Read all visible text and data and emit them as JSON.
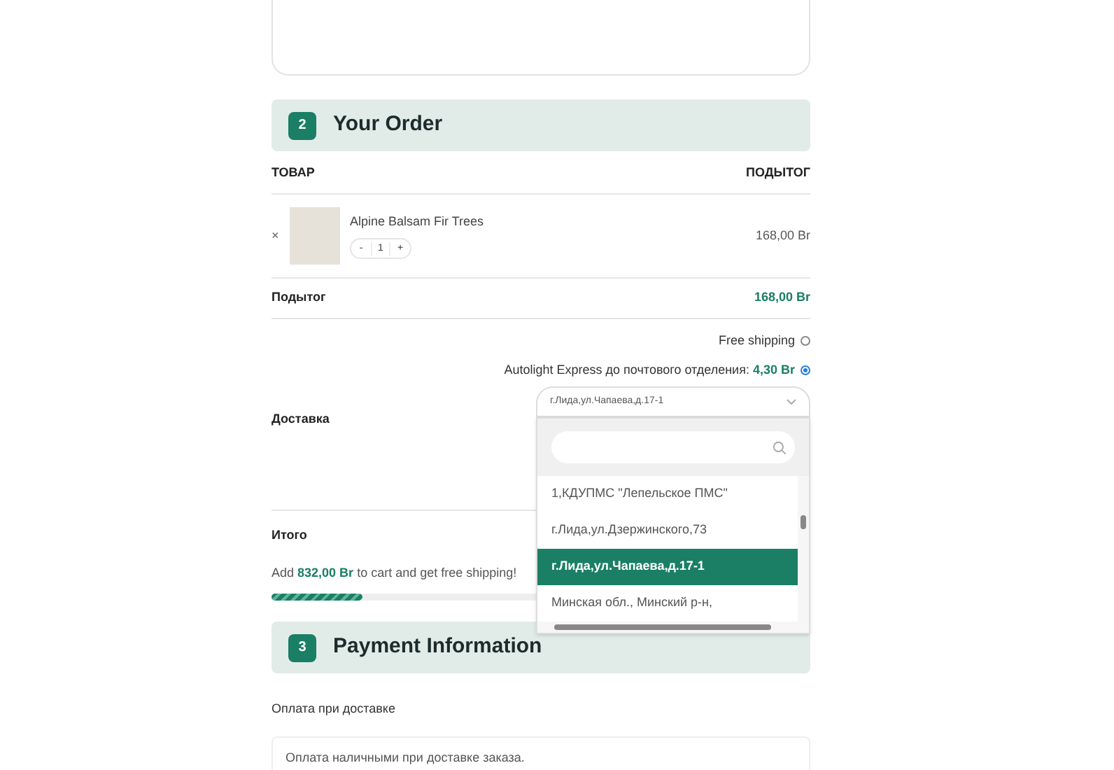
{
  "order_section": {
    "step": "2",
    "title": "Your Order"
  },
  "table": {
    "columns": [
      "ТОВАР",
      "ПОДЫТОГ"
    ],
    "items": [
      {
        "remove": "×",
        "name": "Alpine Balsam Fir Trees",
        "minus": "-",
        "quantity": "1",
        "plus": "+",
        "subtotal": "168,00 Br"
      }
    ]
  },
  "subtotal": {
    "label": "Подытог",
    "value": "168,00 Br"
  },
  "shipping_options": [
    {
      "label": "Free shipping",
      "selected": false
    },
    {
      "label": "Autolight Express до почтового отделения:",
      "price": "4,30 Br",
      "selected": true
    }
  ],
  "delivery": {
    "label": "Доставка",
    "select_value": "г.Лида,ул.Чапаева,д.17-1",
    "dropdown_options": [
      {
        "label": "1,КДУПМС \"Лепельское ПМС\"",
        "selected": false
      },
      {
        "label": "г.Лида,ул.Дзержинского,73",
        "selected": false
      },
      {
        "label": "г.Лида,ул.Чапаева,д.17-1",
        "selected": true
      },
      {
        "label": "Минская обл., Минский р-н,",
        "selected": false
      }
    ]
  },
  "total": {
    "label": "Итого"
  },
  "free_shipping": {
    "before": "Add",
    "amount": "832,00 Br",
    "after": "to cart and get free shipping!",
    "level": 0.168
  },
  "payment_section": {
    "step": "3",
    "title": "Payment Information"
  },
  "payment": {
    "method": "Оплата при доставке",
    "description": "Оплата наличными при доставке заказа."
  }
}
